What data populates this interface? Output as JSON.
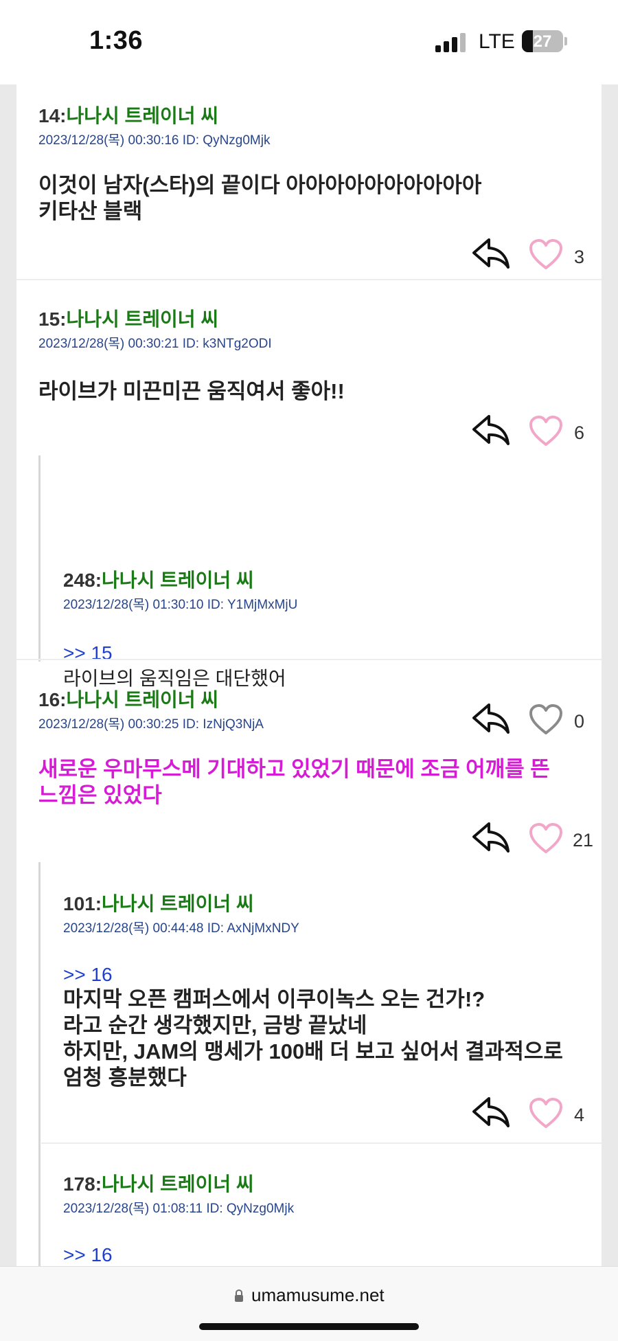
{
  "status_bar": {
    "time": "1:36",
    "network": "LTE",
    "battery": "27"
  },
  "url_bar": {
    "domain": "umamusume.net"
  },
  "colors": {
    "name": "#1a7a16",
    "meta": "#27458c",
    "anchor": "#1f3fd1",
    "pink_text": "#d61bd5",
    "heart": "#f2a6c8"
  },
  "posts": [
    {
      "num": "14:",
      "name": "나나시 트레이너 씨",
      "meta": "2023/12/28(목) 00:30:16 ID: QyNzg0Mjk",
      "body": "이것이 남자(스타)의 끝이다 아아아아아아아아아아\n키타산 블랙",
      "likes": "3"
    },
    {
      "num": "15:",
      "name": "나나시 트레이너 씨",
      "meta": "2023/12/28(목) 00:30:21 ID: k3NTg2ODI",
      "body": "라이브가 미끈미끈 움직여서 좋아!!",
      "likes": "6"
    },
    {
      "num": "248:",
      "name": "나나시 트레이너 씨",
      "meta": "2023/12/28(목) 01:30:10 ID: Y1MjMxMjU",
      "anchor": ">> 15",
      "body": "라이브의 움직임은 대단했어",
      "likes": "0"
    },
    {
      "num": "16:",
      "name": "나나시 트레이너 씨",
      "meta": "2023/12/28(목) 00:30:25 ID: IzNjQ3NjA",
      "body": "새로운 우마무스메 기대하고 있었기 때문에 조금 어깨를 뜬\n느낌은 있었다",
      "likes": "21"
    },
    {
      "num": "101:",
      "name": "나나시 트레이너 씨",
      "meta": "2023/12/28(목) 00:44:48 ID: AxNjMxNDY",
      "anchor": ">> 16",
      "body": "마지막 오픈 캠퍼스에서 이쿠이녹스 오는 건가!?\n라고 순간 생각했지만, 금방 끝났네\n하지만, JAM의 맹세가 100배 더 보고 싶어서 결과적으로\n엄청 흥분했다",
      "likes": "4"
    },
    {
      "num": "178:",
      "name": "나나시 트레이너 씨",
      "meta": "2023/12/28(목) 01:08:11 ID: QyNzg0Mjk",
      "anchor": ">> 16"
    }
  ]
}
